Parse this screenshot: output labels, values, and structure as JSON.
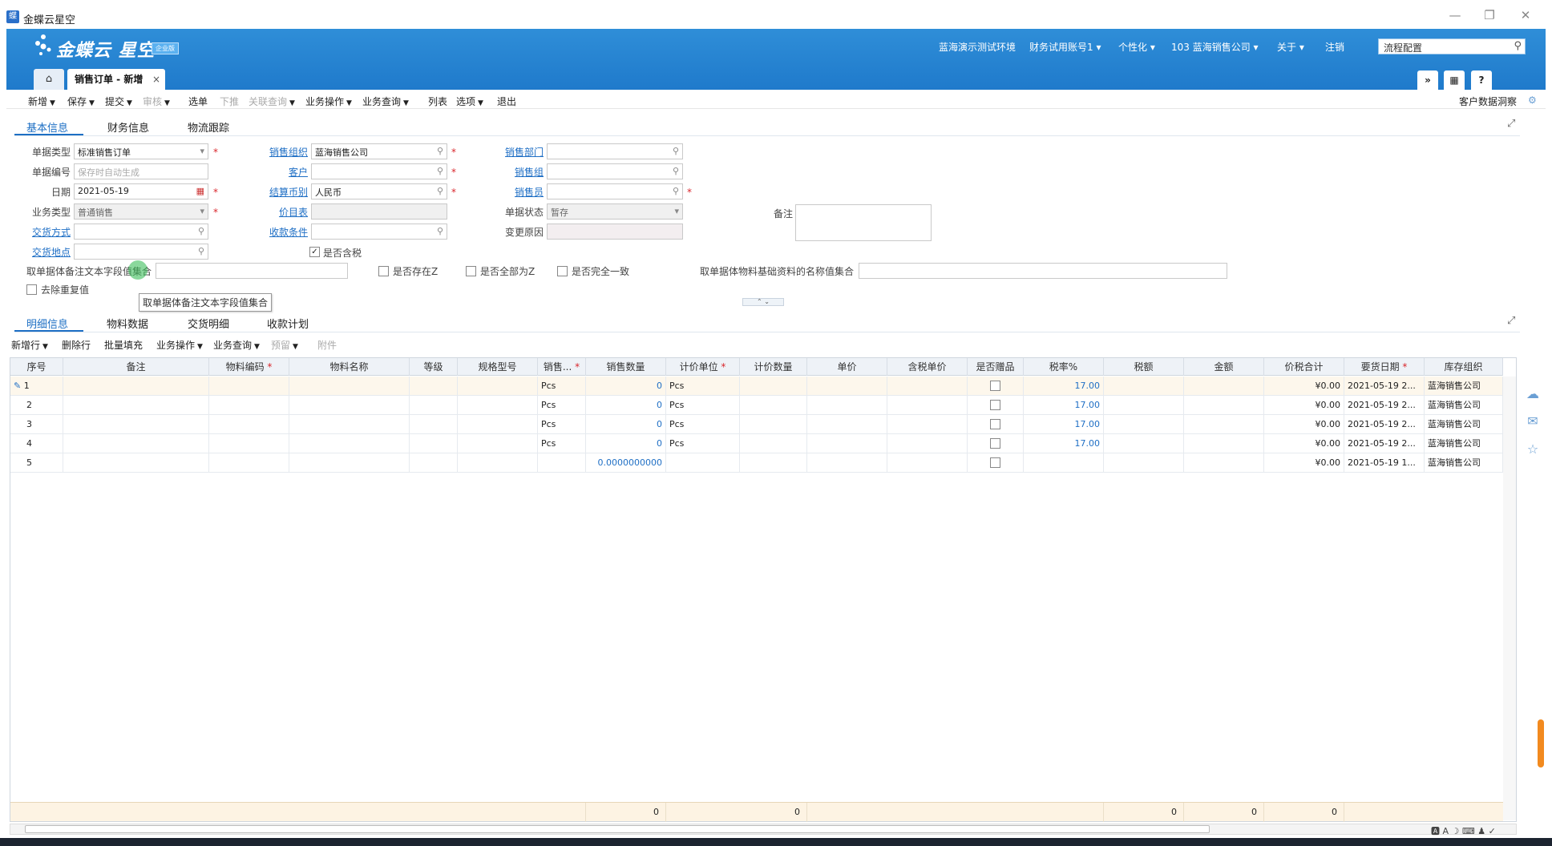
{
  "window": {
    "title": "金蝶云星空",
    "controls": [
      "—",
      "❐",
      "✕"
    ]
  },
  "header": {
    "logo_text": "金蝶云 星空",
    "logo_badge": "企业版",
    "links": [
      "蓝海演示测试环境",
      "财务试用账号1 ▾",
      "个性化 ▾",
      "103  蓝海销售公司 ▾",
      "关于 ▾",
      "注销"
    ],
    "search_value": "流程配置"
  },
  "tabs": {
    "home_icon": "⌂",
    "doc_tab": "销售订单 - 新增",
    "close": "×"
  },
  "toolbar": {
    "items": [
      "新增",
      "保存",
      "提交",
      "审核",
      "选单",
      "下推",
      "关联查询",
      "业务操作",
      "业务查询",
      "列表",
      "选项",
      "退出"
    ],
    "right_text": "客户数据洞察"
  },
  "section_tabs": {
    "tab1": "基本信息",
    "tab2": "财务信息",
    "tab3": "物流跟踪"
  },
  "form": {
    "bill_type_label": "单据类型",
    "bill_type_value": "标准销售订单",
    "bill_no_label": "单据编号",
    "bill_no_placeholder": "保存时自动生成",
    "date_label": "日期",
    "date_value": "2021-05-19",
    "biz_type_label": "业务类型",
    "biz_type_value": "普通销售",
    "delivery_method_label": "交货方式",
    "delivery_place_label": "交货地点",
    "sales_org_label": "销售组织",
    "sales_org_value": "蓝海销售公司",
    "customer_label": "客户",
    "currency_label": "结算币别",
    "currency_value": "人民币",
    "price_list_label": "价目表",
    "payment_terms_label": "收款条件",
    "tax_included_label": "是否含税",
    "sales_dept_label": "销售部门",
    "sales_group_label": "销售组",
    "salesman_label": "销售员",
    "bill_status_label": "单据状态",
    "bill_status_value": "暂存",
    "change_reason_label": "变更原因",
    "remark_label": "备注",
    "remark_collect_label": "取单据体备注文本字段值集合",
    "exists_z_label": "是否存在Z",
    "all_z_label": "是否全部为Z",
    "all_same_label": "是否完全一致",
    "material_names_label": "取单据体物料基础资料的名称值集合",
    "dedup_label": "去除重复值",
    "tooltip": "取单据体备注文本字段值集合",
    "check_mark": "✓"
  },
  "detail_tabs": {
    "tab1": "明细信息",
    "tab2": "物料数据",
    "tab3": "交货明细",
    "tab4": "收款计划"
  },
  "grid_toolbar": {
    "add_row": "新增行",
    "delete_row": "删除行",
    "batch_fill": "批量填充",
    "biz_op": "业务操作",
    "biz_query": "业务查询",
    "reserve": "预留",
    "attachment": "附件"
  },
  "grid": {
    "headers": [
      "序号",
      "备注",
      "物料编码",
      "物料名称",
      "等级",
      "规格型号",
      "销售...",
      "销售数量",
      "计价单位",
      "计价数量",
      "单价",
      "含税单价",
      "是否赠品",
      "税率%",
      "税额",
      "金额",
      "价税合计",
      "要货日期",
      "库存组织"
    ],
    "rows": [
      {
        "seq": "1",
        "unit": "Pcs",
        "qty": "0",
        "price_unit": "Pcs",
        "tax_rate": "17.00",
        "total": "¥0.00",
        "date": "2021-05-19 2...",
        "org": "蓝海销售公司"
      },
      {
        "seq": "2",
        "unit": "Pcs",
        "qty": "0",
        "price_unit": "Pcs",
        "tax_rate": "17.00",
        "total": "¥0.00",
        "date": "2021-05-19 2...",
        "org": "蓝海销售公司"
      },
      {
        "seq": "3",
        "unit": "Pcs",
        "qty": "0",
        "price_unit": "Pcs",
        "tax_rate": "17.00",
        "total": "¥0.00",
        "date": "2021-05-19 2...",
        "org": "蓝海销售公司"
      },
      {
        "seq": "4",
        "unit": "Pcs",
        "qty": "0",
        "price_unit": "Pcs",
        "tax_rate": "17.00",
        "total": "¥0.00",
        "date": "2021-05-19 2...",
        "org": "蓝海销售公司"
      },
      {
        "seq": "5",
        "unit": "",
        "qty": "0.0000000000",
        "price_unit": "",
        "tax_rate": "",
        "total": "¥0.00",
        "date": "2021-05-19 1...",
        "org": "蓝海销售公司"
      }
    ],
    "footer": {
      "qty_sum": "0",
      "price_qty_sum": "0",
      "tax_sum": "0",
      "amount_sum": "0",
      "total_sum": "0"
    }
  },
  "colors": {
    "header_blue": "#2a86d3",
    "link_blue": "#1f6fc5",
    "required_red": "#d9262c"
  }
}
